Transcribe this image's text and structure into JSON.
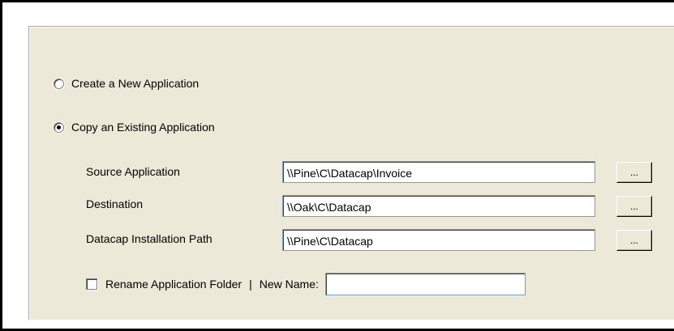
{
  "options": {
    "create_new": {
      "label": "Create a New Application",
      "selected": false
    },
    "copy_existing": {
      "label": "Copy an Existing Application",
      "selected": true
    }
  },
  "fields": {
    "source_application": {
      "label": "Source Application",
      "value": "\\\\Pine\\C\\Datacap\\Invoice",
      "browse_label": "..."
    },
    "destination": {
      "label": "Destination",
      "value": "\\\\Oak\\C\\Datacap",
      "browse_label": "..."
    },
    "install_path": {
      "label": "Datacap Installation Path",
      "value": "\\\\Pine\\C\\Datacap",
      "browse_label": "..."
    }
  },
  "rename": {
    "label": "Rename Application Folder",
    "checked": false,
    "separator": "|",
    "new_name_label": "New Name:",
    "new_name_value": ""
  }
}
